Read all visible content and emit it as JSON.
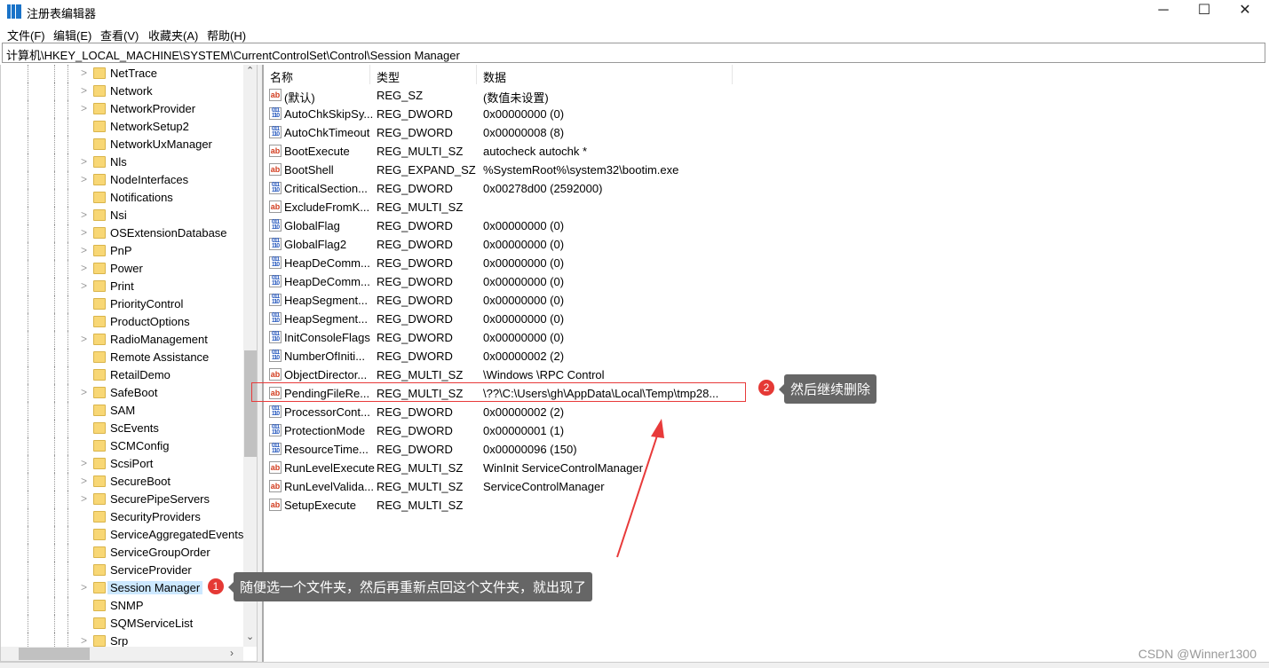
{
  "window": {
    "title": "注册表编辑器",
    "minimize": "─",
    "maximize": "☐",
    "close": "✕"
  },
  "menu": [
    "文件(F)",
    "编辑(E)",
    "查看(V)",
    "收藏夹(A)",
    "帮助(H)"
  ],
  "address": "计算机\\HKEY_LOCAL_MACHINE\\SYSTEM\\CurrentControlSet\\Control\\Session Manager",
  "tree": [
    "NetTrace",
    "Network",
    "NetworkProvider",
    "NetworkSetup2",
    "NetworkUxManager",
    "Nls",
    "NodeInterfaces",
    "Notifications",
    "Nsi",
    "OSExtensionDatabase",
    "PnP",
    "Power",
    "Print",
    "PriorityControl",
    "ProductOptions",
    "RadioManagement",
    "Remote Assistance",
    "RetailDemo",
    "SafeBoot",
    "SAM",
    "ScEvents",
    "SCMConfig",
    "ScsiPort",
    "SecureBoot",
    "SecurePipeServers",
    "SecurityProviders",
    "ServiceAggregatedEvents",
    "ServiceGroupOrder",
    "ServiceProvider",
    "Session Manager",
    "SNMP",
    "SQMServiceList",
    "Srp"
  ],
  "tree_selected": "Session Manager",
  "tree_no_chevron": [
    "NetworkSetup2",
    "NetworkUxManager",
    "Notifications",
    "PriorityControl",
    "ProductOptions",
    "Remote Assistance",
    "RetailDemo",
    "SAM",
    "ScEvents",
    "SCMConfig",
    "SecurityProviders",
    "ServiceAggregatedEvents",
    "ServiceGroupOrder",
    "ServiceProvider",
    "SNMP",
    "SQMServiceList"
  ],
  "columns": [
    "名称",
    "类型",
    "数据"
  ],
  "values": [
    {
      "name": "(默认)",
      "type": "REG_SZ",
      "data": "(数值未设置)",
      "icon": "string-icon"
    },
    {
      "name": "AutoChkSkipSy...",
      "type": "REG_DWORD",
      "data": "0x00000000 (0)",
      "icon": "binary-icon"
    },
    {
      "name": "AutoChkTimeout",
      "type": "REG_DWORD",
      "data": "0x00000008 (8)",
      "icon": "binary-icon"
    },
    {
      "name": "BootExecute",
      "type": "REG_MULTI_SZ",
      "data": "autocheck autochk *",
      "icon": "string-icon"
    },
    {
      "name": "BootShell",
      "type": "REG_EXPAND_SZ",
      "data": "%SystemRoot%\\system32\\bootim.exe",
      "icon": "string-icon"
    },
    {
      "name": "CriticalSection...",
      "type": "REG_DWORD",
      "data": "0x00278d00 (2592000)",
      "icon": "binary-icon"
    },
    {
      "name": "ExcludeFromK...",
      "type": "REG_MULTI_SZ",
      "data": "",
      "icon": "string-icon"
    },
    {
      "name": "GlobalFlag",
      "type": "REG_DWORD",
      "data": "0x00000000 (0)",
      "icon": "binary-icon"
    },
    {
      "name": "GlobalFlag2",
      "type": "REG_DWORD",
      "data": "0x00000000 (0)",
      "icon": "binary-icon"
    },
    {
      "name": "HeapDeComm...",
      "type": "REG_DWORD",
      "data": "0x00000000 (0)",
      "icon": "binary-icon"
    },
    {
      "name": "HeapDeComm...",
      "type": "REG_DWORD",
      "data": "0x00000000 (0)",
      "icon": "binary-icon"
    },
    {
      "name": "HeapSegment...",
      "type": "REG_DWORD",
      "data": "0x00000000 (0)",
      "icon": "binary-icon"
    },
    {
      "name": "HeapSegment...",
      "type": "REG_DWORD",
      "data": "0x00000000 (0)",
      "icon": "binary-icon"
    },
    {
      "name": "InitConsoleFlags",
      "type": "REG_DWORD",
      "data": "0x00000000 (0)",
      "icon": "binary-icon"
    },
    {
      "name": "NumberOfIniti...",
      "type": "REG_DWORD",
      "data": "0x00000002 (2)",
      "icon": "binary-icon"
    },
    {
      "name": "ObjectDirector...",
      "type": "REG_MULTI_SZ",
      "data": "\\Windows \\RPC Control",
      "icon": "string-icon"
    },
    {
      "name": "PendingFileRe...",
      "type": "REG_MULTI_SZ",
      "data": "\\??\\C:\\Users\\gh\\AppData\\Local\\Temp\\tmp28...",
      "icon": "string-icon"
    },
    {
      "name": "ProcessorCont...",
      "type": "REG_DWORD",
      "data": "0x00000002 (2)",
      "icon": "binary-icon"
    },
    {
      "name": "ProtectionMode",
      "type": "REG_DWORD",
      "data": "0x00000001 (1)",
      "icon": "binary-icon"
    },
    {
      "name": "ResourceTime...",
      "type": "REG_DWORD",
      "data": "0x00000096 (150)",
      "icon": "binary-icon"
    },
    {
      "name": "RunLevelExecute",
      "type": "REG_MULTI_SZ",
      "data": "WinInit ServiceControlManager",
      "icon": "string-icon"
    },
    {
      "name": "RunLevelValida...",
      "type": "REG_MULTI_SZ",
      "data": "ServiceControlManager",
      "icon": "string-icon"
    },
    {
      "name": "SetupExecute",
      "type": "REG_MULTI_SZ",
      "data": "",
      "icon": "string-icon"
    }
  ],
  "annotations": {
    "step1": {
      "badge": "1",
      "text": "随便选一个文件夹，然后再重新点回这个文件夹，就出现了"
    },
    "step2": {
      "badge": "2",
      "text": "然后继续删除"
    },
    "accent": "#e53935"
  },
  "watermark": "CSDN @Winner1300"
}
